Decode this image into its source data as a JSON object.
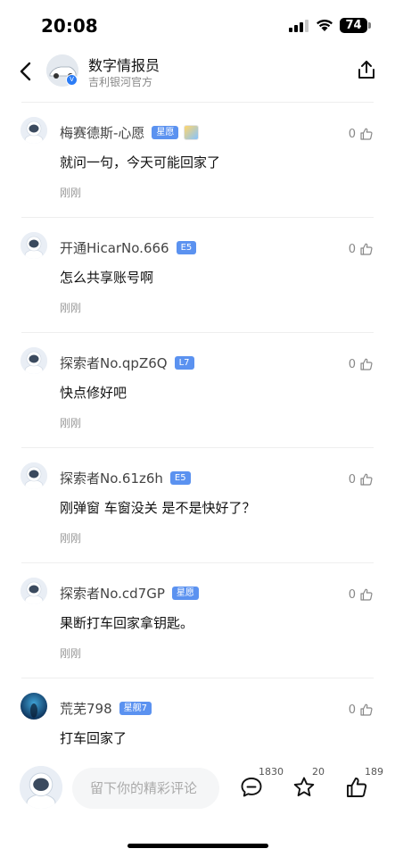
{
  "status_bar": {
    "time": "20:08",
    "battery": "74"
  },
  "header": {
    "title": "数字情报员",
    "subtitle": "吉利银河官方"
  },
  "comments": [
    {
      "author": "梅赛德斯-心愿",
      "badge": "星愿",
      "has_medal": true,
      "text": "就问一句，今天可能回家了",
      "time": "刚刚",
      "likes": "0"
    },
    {
      "author": "开通HicarNo.666",
      "badge": "E5",
      "has_medal": false,
      "text": "怎么共享账号啊",
      "time": "刚刚",
      "likes": "0"
    },
    {
      "author": "探索者No.qpZ6Q",
      "badge": "L7",
      "has_medal": false,
      "text": "快点修好吧",
      "time": "刚刚",
      "likes": "0"
    },
    {
      "author": "探索者No.61z6h",
      "badge": "E5",
      "has_medal": false,
      "text": "刚弹窗 车窗没关 是不是快好了？",
      "time": "刚刚",
      "likes": "0"
    },
    {
      "author": "探索者No.cd7GP",
      "badge": "星愿",
      "has_medal": false,
      "text": "果断打车回家拿钥匙。",
      "time": "刚刚",
      "likes": "0"
    },
    {
      "author": "荒芜798",
      "badge": "星舰7",
      "has_medal": false,
      "text": "打车回家了",
      "time": "",
      "likes": "0"
    }
  ],
  "bottom_bar": {
    "input_placeholder": "留下你的精彩评论",
    "comment_count": "1830",
    "favorite_count": "20",
    "like_count": "189"
  },
  "icons": {
    "back": "chevron-left-icon",
    "share": "share-icon",
    "like": "thumbs-up-icon",
    "comment": "chat-bubble-icon",
    "favorite": "star-icon"
  },
  "colors": {
    "badge": "#5b92f0",
    "verified": "#2b7cf6"
  }
}
